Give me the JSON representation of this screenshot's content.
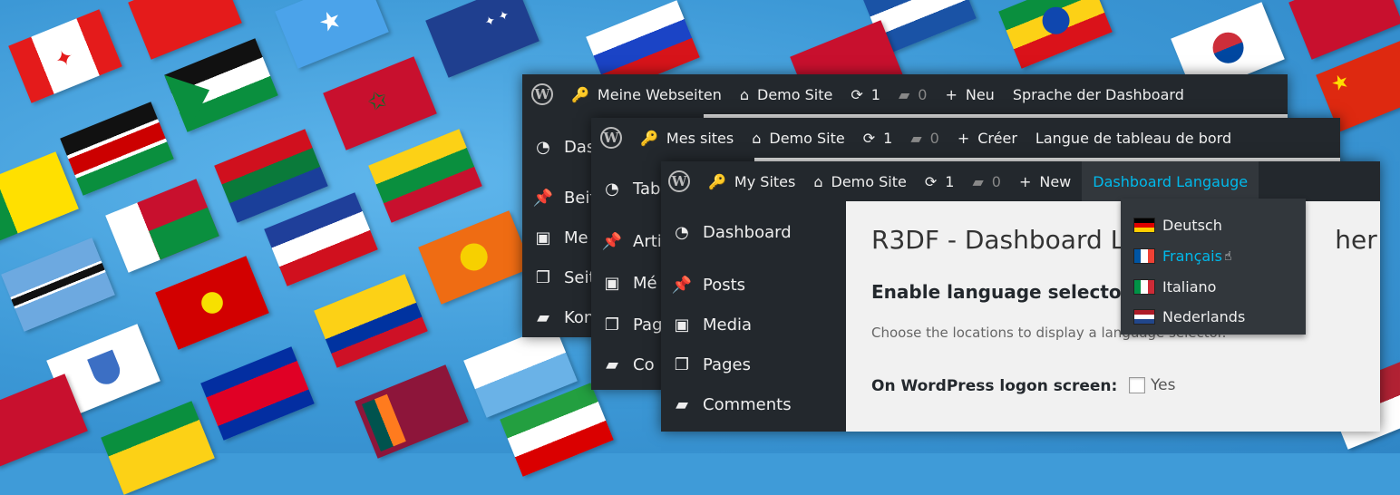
{
  "win1": {
    "bar": {
      "sites": "Meine Webseiten",
      "site": "Demo Site",
      "updates": "1",
      "comments": "0",
      "new": "Neu",
      "lang": "Sprache der Dashboard"
    },
    "menu": [
      "Das",
      "Beit",
      "Me",
      "Seit",
      "Kon"
    ]
  },
  "win2": {
    "bar": {
      "sites": "Mes sites",
      "site": "Demo Site",
      "updates": "1",
      "comments": "0",
      "new": "Créer",
      "lang": "Langue de tableau de bord"
    },
    "menu": [
      "Tab",
      "Arti",
      "Mé",
      "Pag",
      "Co"
    ]
  },
  "win3": {
    "bar": {
      "sites": "My Sites",
      "site": "Demo Site",
      "updates": "1",
      "comments": "0",
      "new": "New",
      "lang": "Dashboard Langauge"
    },
    "menu": [
      "Dashboard",
      "Posts",
      "Media",
      "Pages",
      "Comments"
    ],
    "title": "R3DF - Dashboard L",
    "title_tail": "her",
    "section": "Enable language selectors",
    "description": "Choose the locations to display a language selector.",
    "logon_label": "On WordPress logon screen:",
    "logon_option": "Yes"
  },
  "dropdown": {
    "options": [
      "Deutsch",
      "Français",
      "Italiano",
      "Nederlands"
    ],
    "selected": "Français"
  },
  "colors": {
    "adminbar": "#23282d",
    "accent": "#00b9eb",
    "background": "#3f9bd8"
  }
}
